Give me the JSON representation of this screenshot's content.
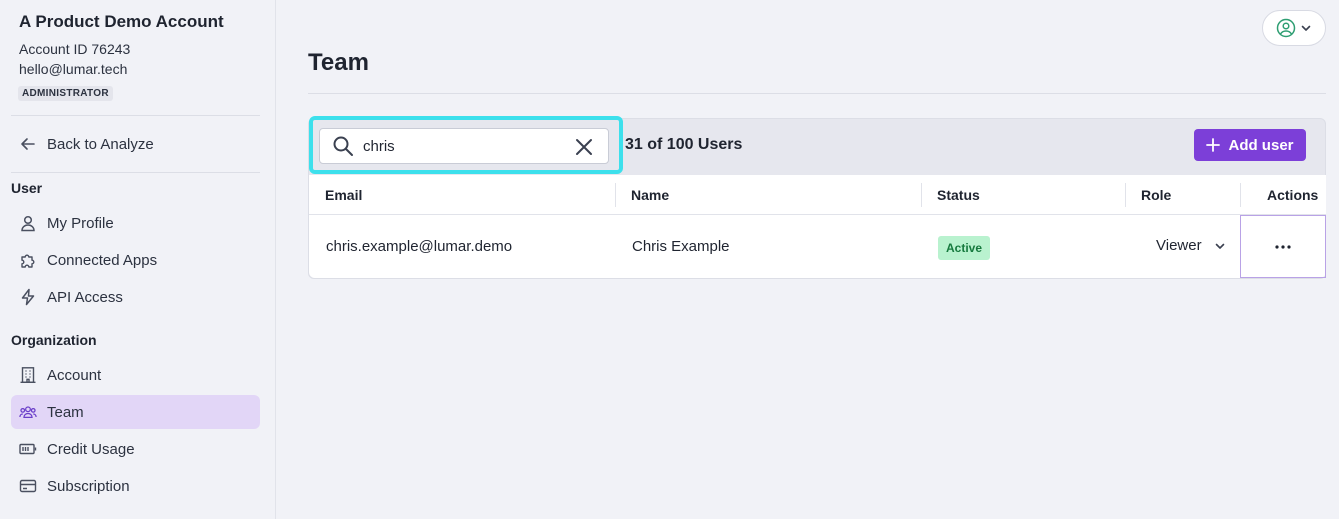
{
  "account": {
    "name": "A Product Demo Account",
    "id": "Account ID 76243",
    "email": "hello@lumar.tech",
    "role": "ADMINISTRATOR"
  },
  "nav": {
    "back": "Back to Analyze",
    "user_section": "User",
    "user_items": [
      {
        "label": "My Profile",
        "icon": "person-icon"
      },
      {
        "label": "Connected Apps",
        "icon": "puzzle-icon"
      },
      {
        "label": "API Access",
        "icon": "lightning-icon"
      }
    ],
    "org_section": "Organization",
    "org_items": [
      {
        "label": "Account",
        "icon": "building-icon"
      },
      {
        "label": "Team",
        "icon": "team-icon",
        "active": true
      },
      {
        "label": "Credit Usage",
        "icon": "battery-icon"
      },
      {
        "label": "Subscription",
        "icon": "card-icon"
      }
    ]
  },
  "page": {
    "title": "Team"
  },
  "search": {
    "value": "chris"
  },
  "user_count": "31 of 100 Users",
  "add_user_label": "Add user",
  "table": {
    "columns": [
      "Email",
      "Name",
      "Status",
      "Role",
      "Actions"
    ],
    "rows": [
      {
        "email": "chris.example@lumar.demo",
        "name": "Chris Example",
        "status": "Active",
        "role": "Viewer"
      }
    ]
  },
  "colors": {
    "accent": "#7c3fd8",
    "focus_ring": "#3de0ec",
    "active_nav": "#e2d6f7",
    "status_active_bg": "#b9f2cf",
    "status_active_text": "#167a3e"
  }
}
